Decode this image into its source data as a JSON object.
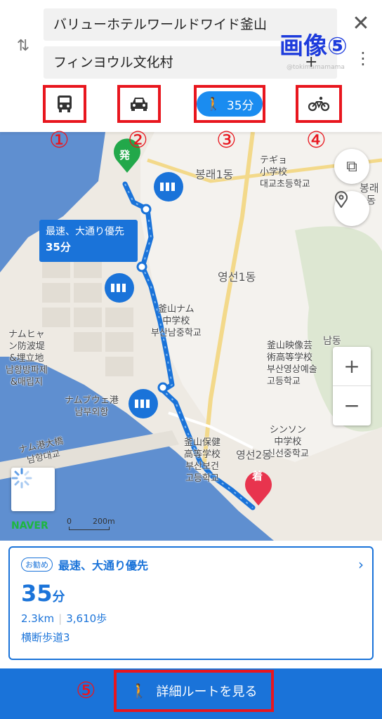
{
  "search": {
    "origin": "バリューホテルワールドワイド釜山",
    "destination": "フィンヨウル文化村",
    "watermark": "@tokimamamama",
    "image_annotation": "画像⑤"
  },
  "modes": [
    {
      "name": "bus",
      "number": "①"
    },
    {
      "name": "car",
      "number": "②"
    },
    {
      "name": "walk",
      "number": "③",
      "time": "35分"
    },
    {
      "name": "bike",
      "number": "④"
    }
  ],
  "map": {
    "route_box": {
      "label": "最速、大通り優先",
      "time": "35分"
    },
    "start_marker": "発",
    "end_marker": "着",
    "labels": [
      "봉래1동",
      "テギョ\n小学校\n대교초등학교",
      "봉래2동",
      "영선1동",
      "釜山ナム\n中学校\n부산남중학교",
      "釜山映像芸\n術高等学校\n부산영상예술\n고등학교",
      "ナムヒャ\nン防波堤\n&埋立地\n남항방파제\n&매립지",
      "ナムブウェ港\n남부외항",
      "ナム港大橋\n남항대교",
      "シンソン\n中学校\n신선중학교",
      "釜山保健\n高等学校\n부산보건\n고등학교",
      "영선2동",
      "남동"
    ],
    "naver": "NAVER",
    "scale_zero": "0",
    "scale_label": "200m",
    "zoom_in": "+",
    "zoom_out": "−"
  },
  "summary": {
    "badge": "お勧め",
    "title": "最速、大通り優先",
    "time_value": "35",
    "time_unit": "分",
    "distance": "2.3km",
    "steps": "3,610歩",
    "crosswalks": "横断歩道3"
  },
  "bottom": {
    "number": "⑤",
    "label": "詳細ルートを見る"
  },
  "colors": {
    "accent": "#1a73d9",
    "annotation": "#e8161e",
    "water": "#5f8fd0",
    "start_marker": "#22a84a",
    "end_marker": "#e8344e"
  }
}
